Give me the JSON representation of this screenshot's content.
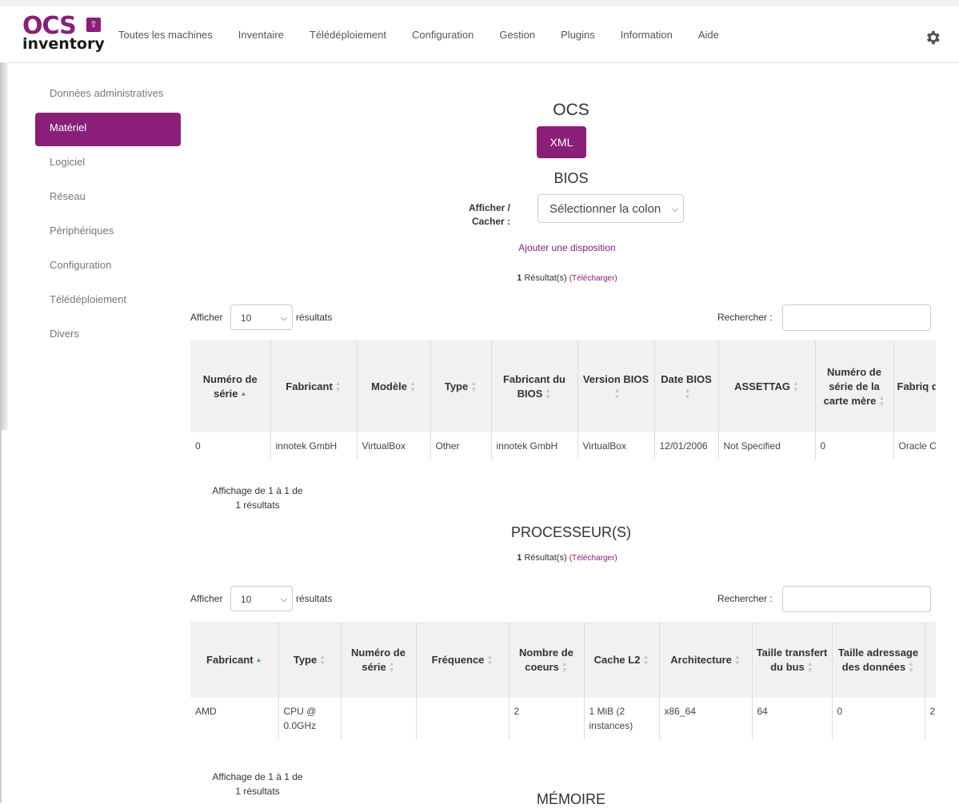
{
  "app": {
    "logo_top": "OCS",
    "logo_bottom": "inventory",
    "brand_color": "#8a1e79"
  },
  "nav": {
    "items": [
      "Toutes les machines",
      "Inventaire",
      "Télédéploiement",
      "Configuration",
      "Gestion",
      "Plugins",
      "Information",
      "Aide"
    ],
    "settings_icon": "gear-icon"
  },
  "sidebar": {
    "items": [
      {
        "label": "Données administratives",
        "active": false
      },
      {
        "label": "Matériel",
        "active": true
      },
      {
        "label": "Logiciel",
        "active": false
      },
      {
        "label": "Réseau",
        "active": false
      },
      {
        "label": "Périphériques",
        "active": false
      },
      {
        "label": "Configuration",
        "active": false
      },
      {
        "label": "Télédéploiement",
        "active": false
      },
      {
        "label": "Divers",
        "active": false
      }
    ]
  },
  "main": {
    "title": "OCS",
    "xml_button": "XML",
    "bios": {
      "heading": "BIOS",
      "toggle_label": "Afficher / Cacher :",
      "column_select": "Sélectionner la colon",
      "add_layout": "Ajouter une disposition",
      "result_count": "1",
      "result_text": "Résultat(s)",
      "download": "(Télécharger)",
      "show_label": "Afficher",
      "page_length": "10",
      "results_label": "résultats",
      "search_label": "Rechercher :",
      "search_value": "",
      "columns": [
        "Numéro de série",
        "Fabricant",
        "Modèle",
        "Type",
        "Fabricant du BIOS",
        "Version BIOS",
        "Date BIOS",
        "ASSETTAG",
        "Numéro de série de la carte mère",
        "Fabriq de la c mèr"
      ],
      "rows": [
        [
          "0",
          "innotek GmbH",
          "VirtualBox",
          "Other",
          "innotek GmbH",
          "VirtualBox",
          "12/01/2006",
          "Not Specified",
          "0",
          "Oracle Corporatio"
        ]
      ],
      "info": "Affichage de 1 à 1 de 1 résultats"
    },
    "cpu": {
      "heading": "PROCESSEUR(S)",
      "result_count": "1",
      "result_text": "Résultat(s)",
      "download": "(Télécharger)",
      "show_label": "Afficher",
      "page_length": "10",
      "results_label": "résultats",
      "search_label": "Rechercher :",
      "search_value": "",
      "columns": [
        "Fabricant",
        "Type",
        "Numéro de série",
        "Fréquence",
        "Nombre de coeurs",
        "Cache L2",
        "Architecture",
        "Taille transfert du bus",
        "Taille adressage des données",
        ""
      ],
      "rows": [
        [
          "AMD",
          "CPU @ 0.0GHz",
          "",
          "",
          "2",
          "1 MiB (2 instances)",
          "x86_64",
          "64",
          "0",
          "2"
        ]
      ],
      "info": "Affichage de 1 à 1 de 1 résultats"
    },
    "memory": {
      "heading": "MÉMOIRE"
    }
  }
}
